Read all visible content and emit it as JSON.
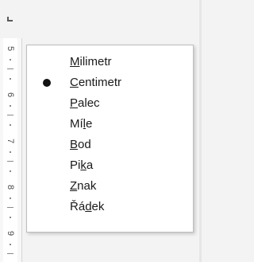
{
  "ruler": {
    "corner_icon": "tab-stop-left-icon",
    "numbers": [
      "5",
      "6",
      "7",
      "8",
      "9"
    ]
  },
  "menu": {
    "items": [
      {
        "pre": "",
        "ul": "M",
        "post": "ilimetr",
        "selected": false
      },
      {
        "pre": "",
        "ul": "C",
        "post": "entimetr",
        "selected": true
      },
      {
        "pre": "",
        "ul": "P",
        "post": "alec",
        "selected": false
      },
      {
        "pre": "Mí",
        "ul": "l",
        "post": "e",
        "selected": false
      },
      {
        "pre": "",
        "ul": "B",
        "post": "od",
        "selected": false
      },
      {
        "pre": "Pi",
        "ul": "k",
        "post": "a",
        "selected": false
      },
      {
        "pre": "",
        "ul": "Z",
        "post": "nak",
        "selected": false
      },
      {
        "pre": "Řá",
        "ul": "d",
        "post": "ek",
        "selected": false
      }
    ]
  },
  "colors": {
    "menu_bg": "#ffffff",
    "menu_border": "#bdbdbd",
    "text": "#1a1a1a",
    "ruler_bg": "#ffffff"
  }
}
